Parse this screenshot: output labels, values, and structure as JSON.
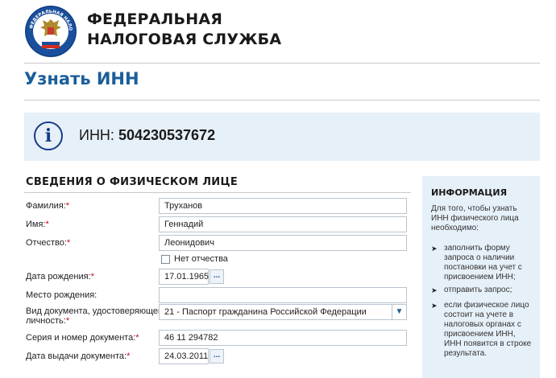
{
  "header": {
    "org_line1": "ФЕДЕРАЛЬНАЯ",
    "org_line2": "НАЛОГОВАЯ СЛУЖБА",
    "logo_text": "ФЕДЕРАЛЬНАЯ НАЛОГОВАЯ СЛУЖБА"
  },
  "page_title": "Узнать ИНН",
  "result": {
    "label": "ИНН:",
    "value": "504230537672"
  },
  "section_title": "СВЕДЕНИЯ О ФИЗИЧЕСКОМ ЛИЦЕ",
  "form": {
    "surname": {
      "label": "Фамилия:",
      "required": "*",
      "value": "Труханов"
    },
    "name": {
      "label": "Имя:",
      "required": "*",
      "value": "Геннадий"
    },
    "patronymic": {
      "label": "Отчество:",
      "required": "*",
      "value": "Леонидович"
    },
    "no_patronymic": {
      "label": "Нет отчества",
      "checked": false
    },
    "birth_date": {
      "label": "Дата рождения:",
      "required": "*",
      "value": "17.01.1965",
      "button": "..."
    },
    "birth_place": {
      "label": "Место рождения:",
      "value": ""
    },
    "doc_type": {
      "label_line1": "Вид документа, удостоверяющего",
      "label_line2": "личность:",
      "required": "*",
      "value": "21 - Паспорт гражданина Российской Федерации"
    },
    "doc_number": {
      "label": "Серия и номер документа:",
      "required": "*",
      "value": "46 11 294782"
    },
    "issue_date": {
      "label": "Дата выдачи документа:",
      "required": "*",
      "value": "24.03.2011",
      "button": "..."
    }
  },
  "sidebar": {
    "title": "ИНФОРМАЦИЯ",
    "intro": "Для того, чтобы узнать ИНН физического лица необходимо:",
    "items": [
      "заполнить форму запроса о наличии постановки на учет с присвоением ИНН;",
      "отправить запрос;",
      "если физическое лицо состоит на учете в налоговых органах с присвоением ИНН, ИНН появится в строке результата."
    ]
  },
  "colors": {
    "accent": "#1a5e9a",
    "info_bg": "#e6f0f8",
    "required": "#d0021b"
  }
}
